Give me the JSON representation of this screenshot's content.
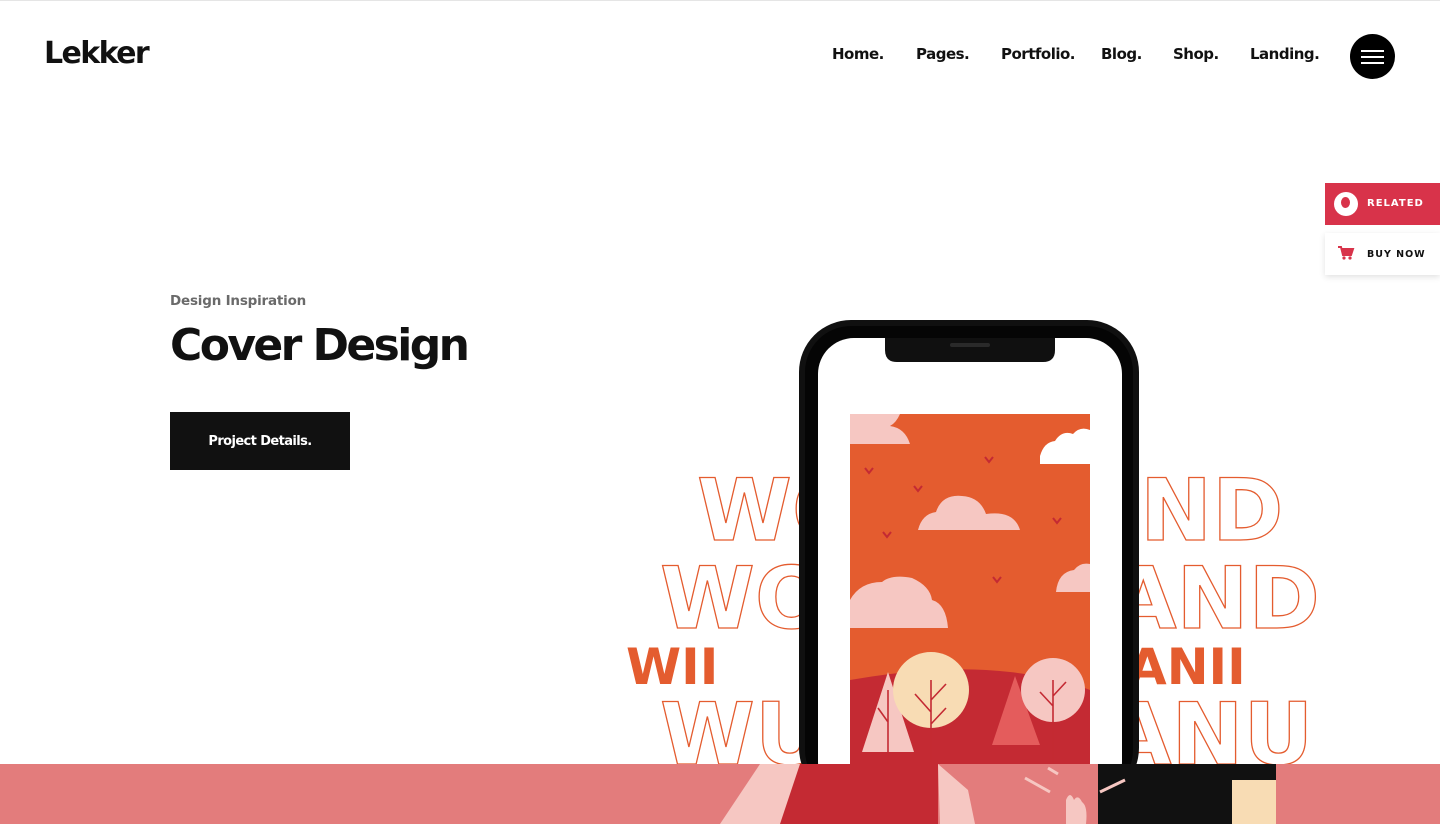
{
  "brand": {
    "logo_text": "Lekker"
  },
  "nav": {
    "items": [
      {
        "label": "Home."
      },
      {
        "label": "Pages."
      },
      {
        "label": "Portfolio."
      },
      {
        "label": "Blog."
      },
      {
        "label": "Shop."
      },
      {
        "label": "Landing."
      }
    ],
    "menu_icon": "hamburger-icon"
  },
  "side_widgets": {
    "related_label": "RELATED",
    "related_icon": "related-logo-icon",
    "buy_label": "BUY NOW",
    "buy_icon": "cart-icon"
  },
  "hero": {
    "eyebrow": "Design Inspiration",
    "title": "Cover Design",
    "button_label": "Project Details."
  },
  "artwork": {
    "words": [
      "WO",
      "ND",
      "WO",
      "AND",
      "WII",
      "ANII",
      "WU",
      "ANU"
    ]
  },
  "colors": {
    "accent_red": "#d8334a",
    "orange": "#e45c2f",
    "pink_band": "#e37c7c",
    "dark": "#111111"
  }
}
